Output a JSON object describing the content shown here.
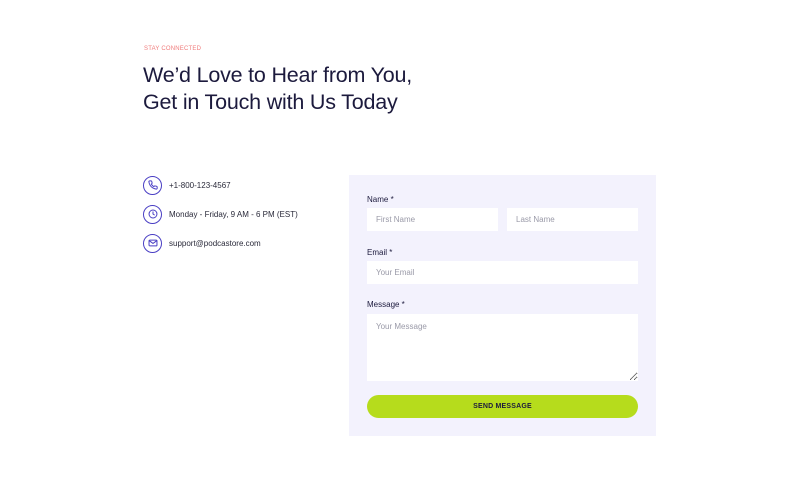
{
  "header": {
    "eyebrow": "STAY CONNECTED",
    "title": "We’d Love to Hear from You, Get in Touch with Us Today"
  },
  "contacts": [
    {
      "icon": "phone-icon",
      "text": "+1-800-123-4567"
    },
    {
      "icon": "clock-icon",
      "text": "Monday - Friday, 9 AM - 6 PM (EST)"
    },
    {
      "icon": "mail-icon",
      "text": "support@podcastore.com"
    }
  ],
  "form": {
    "name_label": "Name *",
    "first_name_placeholder": "First Name",
    "last_name_placeholder": "Last Name",
    "email_label": "Email *",
    "email_placeholder": "Your Email",
    "message_label": "Message *",
    "message_placeholder": "Your Message",
    "submit_label": "SEND MESSAGE"
  },
  "colors": {
    "accent": "#4a3fc4",
    "button": "#b6dc1c",
    "eyebrow": "#f07c7c",
    "form_background": "#f3f2fd"
  }
}
